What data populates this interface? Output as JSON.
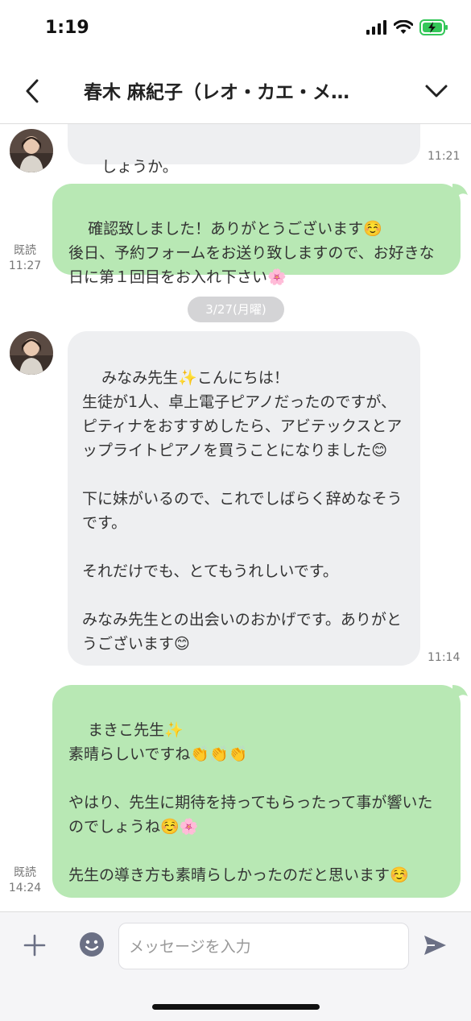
{
  "status": {
    "time": "1:19"
  },
  "header": {
    "title": "春木 麻紀子（レオ・カエ・メ…"
  },
  "messages": [
    {
      "id": "m0",
      "side": "in",
      "text": "しょうか。",
      "time": "11:21"
    },
    {
      "id": "m1",
      "side": "out",
      "text": "確認致しました！ありがとうございます☺️\n後日、予約フォームをお送り致しますので、お好きな日に第１回目をお入れ下さい🌸",
      "read": "既読",
      "time": "11:27"
    },
    {
      "id": "m2",
      "side": "in",
      "text": "みなみ先生✨こんにちは！\n生徒が1人、卓上電子ピアノだったのですが、ピティナをおすすめしたら、アビテックスとアップライトピアノを買うことになりました😊\n\n下に妹がいるので、これでしばらく辞めなそうです。\n\nそれだけでも、とてもうれしいです。\n\nみなみ先生との出会いのおかげです。ありがとうございます😊",
      "time": "11:14"
    },
    {
      "id": "m3",
      "side": "out",
      "text": "まきこ先生✨\n素晴らしいですね👏👏👏\n\nやはり、先生に期待を持ってもらったって事が響いたのでしょうね☺️🌸\n\n先生の導き方も素晴らしかったのだと思います☺️",
      "read": "既読",
      "time": "14:24"
    }
  ],
  "date_separator": "3/27(月曜)",
  "input": {
    "placeholder": "メッセージを入力"
  },
  "icons": {
    "back": "chevron-left-icon",
    "menu": "chevron-down-icon",
    "plus": "plus-icon",
    "emoji": "emoji-icon",
    "send": "send-icon"
  },
  "colors": {
    "outgoing_bubble": "#b8e8b4",
    "incoming_bubble": "#eeeff1",
    "battery": "#34c759"
  }
}
